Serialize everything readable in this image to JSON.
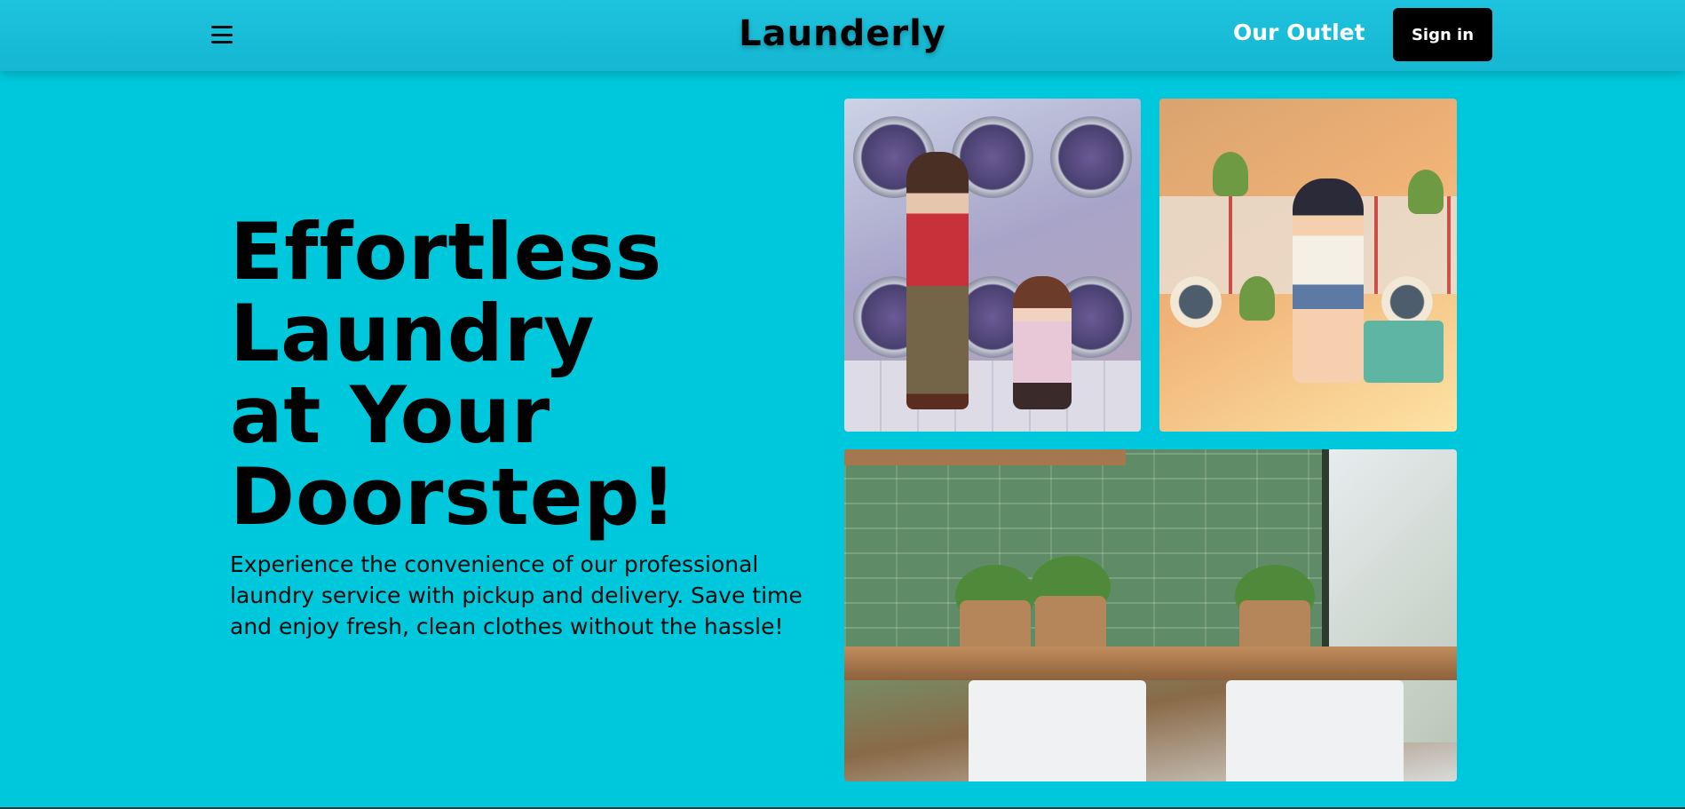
{
  "header": {
    "brand": "Launderly",
    "outlet_link": "Our Outlet",
    "signin_label": "Sign in",
    "menu_icon": "hamburger-menu-icon"
  },
  "hero": {
    "title_lines": [
      "Effortless",
      "Laundry",
      "at Your",
      "Doorstep!"
    ],
    "description": "Experience the convenience of our professional laundry service with pickup and delivery. Save time and enjoy fresh, clean clothes without the hassle!"
  },
  "colors": {
    "background": "#00c8dc",
    "header": "#1ab9d5",
    "button": "#000000",
    "button_text": "#ffffff",
    "title": "#000000"
  }
}
